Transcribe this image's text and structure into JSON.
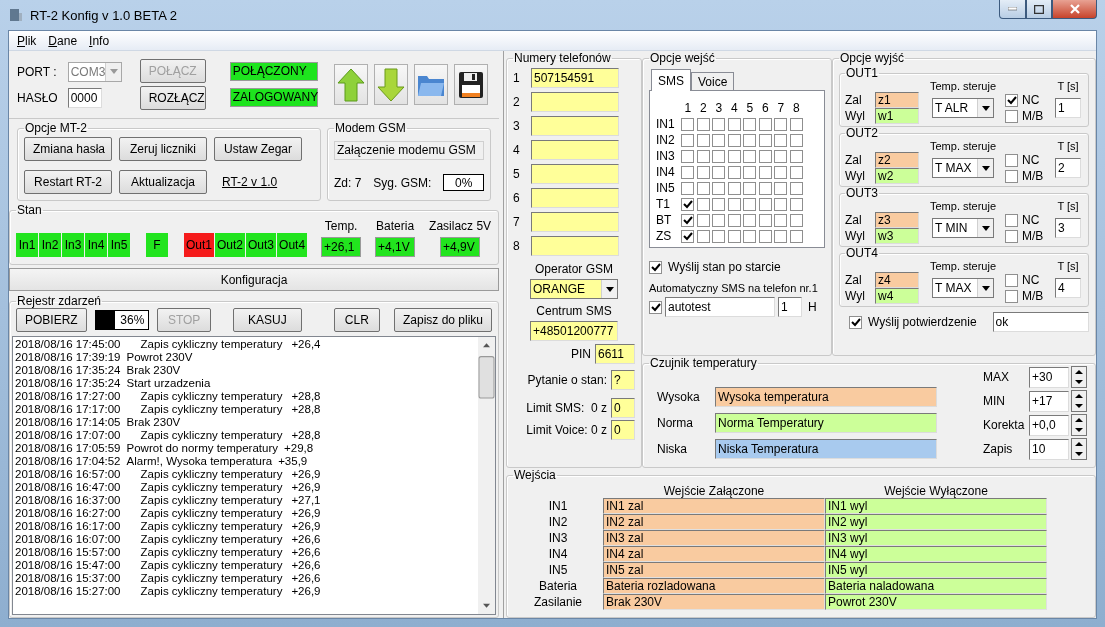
{
  "window": {
    "title": "RT-2 Konfig v 1.0  BETA 2"
  },
  "menu": [
    "Plik",
    "Dane",
    "Info"
  ],
  "connection": {
    "port_label": "PORT :",
    "port": "COM3",
    "port_disabled": true,
    "password_label": "HASŁO",
    "password": "0000",
    "buttons": [
      {
        "label": "POŁĄCZ",
        "disabled": true
      },
      {
        "label": "ROZŁĄCZ",
        "disabled": false
      }
    ],
    "status": [
      "POŁĄCZONY",
      "ZALOGOWANY"
    ]
  },
  "mt2_options": {
    "title": "Opcje MT-2",
    "buttons": [
      "Zmiana hasła",
      "Zeruj liczniki",
      "Ustaw Zegar",
      "Restart RT-2",
      "Aktualizacja"
    ],
    "version_link": "RT-2 v 1.0"
  },
  "modem": {
    "title": "Modem GSM",
    "status": "Załączenie modemu GSM",
    "zd": "Zd: 7",
    "signal_label": "Syg. GSM:",
    "signal": {
      "text": "0%",
      "level": 0
    }
  },
  "state": {
    "title": "Stan",
    "inputs": [
      {
        "label": "In1",
        "alarm": false
      },
      {
        "label": "In2",
        "alarm": false
      },
      {
        "label": "In3",
        "alarm": false
      },
      {
        "label": "In4",
        "alarm": false
      },
      {
        "label": "In5",
        "alarm": false
      }
    ],
    "flag": {
      "label": "F",
      "alarm": false
    },
    "outputs": [
      {
        "label": "Out1",
        "alarm": true
      },
      {
        "label": "Out2",
        "alarm": false
      },
      {
        "label": "Out3",
        "alarm": false
      },
      {
        "label": "Out4",
        "alarm": false
      }
    ],
    "readings": [
      {
        "label": "Temp.",
        "value": "+26,1"
      },
      {
        "label": "Bateria",
        "value": "+4,1V"
      },
      {
        "label": "Zasilacz 5V",
        "value": "+4,9V"
      }
    ]
  },
  "config_button": "Konfiguracja",
  "log": {
    "title": "Rejestr zdarzeń",
    "download_button": "POBIERZ",
    "progress": {
      "text": "36%",
      "level": 0.36
    },
    "buttons": [
      {
        "label": "STOP",
        "disabled": true
      },
      {
        "label": "KASUJ",
        "disabled": false
      },
      {
        "label": "CLR",
        "disabled": false
      },
      {
        "label": "Zapisz do pliku",
        "disabled": false
      }
    ],
    "entries": [
      {
        "time": "2018/08/16 17:45:00",
        "kind": "cyclic",
        "text": "Zapis cykliczny temperatury",
        "value": "+26,4"
      },
      {
        "time": "2018/08/16 17:39:19",
        "kind": "event",
        "text": "Powrot 230V"
      },
      {
        "time": "2018/08/16 17:35:24",
        "kind": "event",
        "text": "Brak 230V"
      },
      {
        "time": "2018/08/16 17:35:24",
        "kind": "event",
        "text": "Start urzadzenia"
      },
      {
        "time": "2018/08/16 17:27:00",
        "kind": "cyclic",
        "text": "Zapis cykliczny temperatury",
        "value": "+28,8"
      },
      {
        "time": "2018/08/16 17:17:00",
        "kind": "cyclic",
        "text": "Zapis cykliczny temperatury",
        "value": "+28,8"
      },
      {
        "time": "2018/08/16 17:14:05",
        "kind": "event",
        "text": "Brak 230V"
      },
      {
        "time": "2018/08/16 17:07:00",
        "kind": "cyclic",
        "text": "Zapis cykliczny temperatury",
        "value": "+28,8"
      },
      {
        "time": "2018/08/16 17:05:59",
        "kind": "event",
        "text": "Powrot do normy temperatury",
        "value": "+29,8"
      },
      {
        "time": "2018/08/16 17:04:52",
        "kind": "event",
        "text": "Alarm!, Wysoka temperatura",
        "value": "+35,9"
      },
      {
        "time": "2018/08/16 16:57:00",
        "kind": "cyclic",
        "text": "Zapis cykliczny temperatury",
        "value": "+26,9"
      },
      {
        "time": "2018/08/16 16:47:00",
        "kind": "cyclic",
        "text": "Zapis cykliczny temperatury",
        "value": "+26,9"
      },
      {
        "time": "2018/08/16 16:37:00",
        "kind": "cyclic",
        "text": "Zapis cykliczny temperatury",
        "value": "+27,1"
      },
      {
        "time": "2018/08/16 16:27:00",
        "kind": "cyclic",
        "text": "Zapis cykliczny temperatury",
        "value": "+26,9"
      },
      {
        "time": "2018/08/16 16:17:00",
        "kind": "cyclic",
        "text": "Zapis cykliczny temperatury",
        "value": "+26,9"
      },
      {
        "time": "2018/08/16 16:07:00",
        "kind": "cyclic",
        "text": "Zapis cykliczny temperatury",
        "value": "+26,6"
      },
      {
        "time": "2018/08/16 15:57:00",
        "kind": "cyclic",
        "text": "Zapis cykliczny temperatury",
        "value": "+26,6"
      },
      {
        "time": "2018/08/16 15:47:00",
        "kind": "cyclic",
        "text": "Zapis cykliczny temperatury",
        "value": "+26,6"
      },
      {
        "time": "2018/08/16 15:37:00",
        "kind": "cyclic",
        "text": "Zapis cykliczny temperatury",
        "value": "+26,6"
      },
      {
        "time": "2018/08/16 15:27:00",
        "kind": "cyclic",
        "text": "Zapis cykliczny temperatury",
        "value": "+26,9"
      }
    ]
  },
  "phones": {
    "title": "Numery telefonów",
    "numbers": [
      {
        "index": "1",
        "value": "507154591"
      },
      {
        "index": "2"
      },
      {
        "index": "3"
      },
      {
        "index": "4"
      },
      {
        "index": "5"
      },
      {
        "index": "6"
      },
      {
        "index": "7"
      },
      {
        "index": "8"
      }
    ],
    "operator_label": "Operator GSM",
    "operator": "ORANGE",
    "sms_center_label": "Centrum SMS",
    "sms_center": "+48501200777",
    "pin_label": "PIN",
    "pin": "6611",
    "query_label": "Pytanie o stan:",
    "query": "?",
    "limits": [
      {
        "label": "Limit SMS:  0 z",
        "value": "0"
      },
      {
        "label": "Limit Voice: 0 z",
        "value": "0"
      }
    ]
  },
  "input_options": {
    "title": "Opcje wejść",
    "tabs": [
      {
        "label": "SMS",
        "selected": true
      },
      {
        "label": "Voice",
        "selected": false
      }
    ],
    "columns": [
      "1",
      "2",
      "3",
      "4",
      "5",
      "6",
      "7",
      "8"
    ],
    "rows": [
      {
        "label": "IN1",
        "checks": [
          false,
          false,
          false,
          false,
          false,
          false,
          false,
          false
        ]
      },
      {
        "label": "IN2",
        "checks": [
          false,
          false,
          false,
          false,
          false,
          false,
          false,
          false
        ]
      },
      {
        "label": "IN3",
        "checks": [
          false,
          false,
          false,
          false,
          false,
          false,
          false,
          false
        ]
      },
      {
        "label": "IN4",
        "checks": [
          false,
          false,
          false,
          false,
          false,
          false,
          false,
          false
        ]
      },
      {
        "label": "IN5",
        "checks": [
          false,
          false,
          false,
          false,
          false,
          false,
          false,
          false
        ]
      },
      {
        "label": "T1",
        "checks": [
          true,
          false,
          false,
          false,
          false,
          false,
          false,
          false
        ]
      },
      {
        "label": "BT",
        "checks": [
          true,
          false,
          false,
          false,
          false,
          false,
          false,
          false
        ]
      },
      {
        "label": "ZS",
        "checks": [
          true,
          false,
          false,
          false,
          false,
          false,
          false,
          false
        ]
      }
    ],
    "send_on_start": {
      "label": "Wyślij stan po starcie",
      "checked": true
    },
    "auto_sms_label": "Automatyczny SMS na telefon nr.1",
    "auto_sms": {
      "checked": true,
      "text": "autotest",
      "interval": "1",
      "unit": "H"
    }
  },
  "output_options": {
    "title": "Opcje wyjść",
    "outputs": [
      {
        "title": "OUT1",
        "on_label": "Zal",
        "on_value": "z1",
        "off_label": "Wyl",
        "off_value": "w1",
        "control_label": "Temp. steruje",
        "control": "T ALR",
        "nc": {
          "label": "NC",
          "checked": true
        },
        "mb": {
          "label": "M/B",
          "checked": false
        },
        "time_label": "T [s]",
        "time": "1"
      },
      {
        "title": "OUT2",
        "on_label": "Zal",
        "on_value": "z2",
        "off_label": "Wyl",
        "off_value": "w2",
        "control_label": "Temp. steruje",
        "control": "T MAX",
        "nc": {
          "label": "NC",
          "checked": false
        },
        "mb": {
          "label": "M/B",
          "checked": false
        },
        "time_label": "T [s]",
        "time": "2"
      },
      {
        "title": "OUT3",
        "on_label": "Zal",
        "on_value": "z3",
        "off_label": "Wyl",
        "off_value": "w3",
        "control_label": "Temp. steruje",
        "control": "T MIN",
        "nc": {
          "label": "NC",
          "checked": false
        },
        "mb": {
          "label": "M/B",
          "checked": false
        },
        "time_label": "T [s]",
        "time": "3"
      },
      {
        "title": "OUT4",
        "on_label": "Zal",
        "on_value": "z4",
        "off_label": "Wyl",
        "off_value": "w4",
        "control_label": "Temp. steruje",
        "control": "T MAX",
        "nc": {
          "label": "NC",
          "checked": false
        },
        "mb": {
          "label": "M/B",
          "checked": false
        },
        "time_label": "T [s]",
        "time": "4"
      }
    ],
    "confirm": {
      "label": "Wyślij potwierdzenie",
      "checked": true,
      "text": "ok"
    }
  },
  "temp_sensor": {
    "title": "Czujnik temperatury",
    "messages": [
      {
        "label": "Wysoka",
        "value": "Wysoka temperatura",
        "color": "#f9cba0"
      },
      {
        "label": "Norma",
        "value": "Norma Temperatury",
        "color": "#ccff99"
      },
      {
        "label": "Niska",
        "value": "Niska Temperatura",
        "color": "#a8caee"
      }
    ],
    "settings": [
      {
        "label": "MAX",
        "value": "+30"
      },
      {
        "label": "MIN",
        "value": "+17"
      },
      {
        "label": "Korekta",
        "value": "+0,0"
      },
      {
        "label": "Zapis",
        "value": "10"
      }
    ]
  },
  "inputs": {
    "title": "Wejścia",
    "columns": [
      "Wejście Załączone",
      "Wejście Wyłączone"
    ],
    "rows": [
      {
        "label": "IN1",
        "on": "IN1 zal",
        "off": "IN1 wyl"
      },
      {
        "label": "IN2",
        "on": "IN2 zal",
        "off": "IN2 wyl"
      },
      {
        "label": "IN3",
        "on": "IN3 zal",
        "off": "IN3 wyl"
      },
      {
        "label": "IN4",
        "on": "IN4 zal",
        "off": "IN4 wyl"
      },
      {
        "label": "IN5",
        "on": "IN5 zal",
        "off": "IN5 wyl"
      },
      {
        "label": "Bateria",
        "on": "Bateria rozladowana",
        "off": "Bateria naladowana"
      },
      {
        "label": "Zasilanie",
        "on": "Brak 230V",
        "off": "Powrot 230V"
      }
    ]
  }
}
